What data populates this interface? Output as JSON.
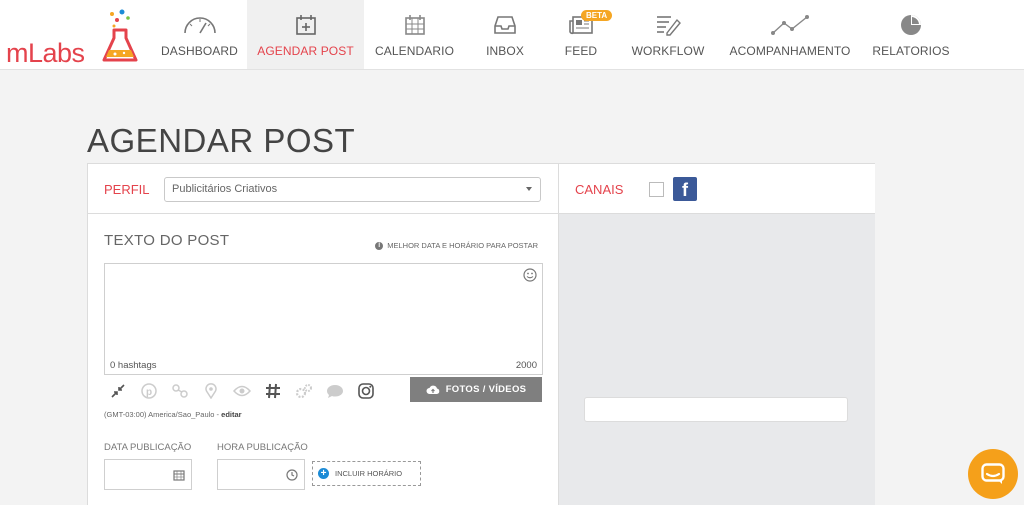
{
  "logo": {
    "text_m": "m",
    "text_labs": "Labs"
  },
  "nav": {
    "items": [
      {
        "label": "DASHBOARD",
        "icon": "gauge-icon"
      },
      {
        "label": "AGENDAR POST",
        "icon": "calendar-plus-icon",
        "active": true
      },
      {
        "label": "CALENDARIO",
        "icon": "calendar-icon"
      },
      {
        "label": "INBOX",
        "icon": "inbox-icon"
      },
      {
        "label": "FEED",
        "icon": "newspaper-icon",
        "badge": "BETA"
      },
      {
        "label": "WORKFLOW",
        "icon": "workflow-icon"
      },
      {
        "label": "ACOMPANHAMENTO",
        "icon": "line-chart-icon"
      },
      {
        "label": "RELATORIOS",
        "icon": "pie-chart-icon"
      }
    ]
  },
  "page": {
    "title": "AGENDAR POST"
  },
  "perfil": {
    "label": "PERFIL",
    "selected": "Publicitários Criativos"
  },
  "canais": {
    "label": "CANAIS",
    "facebook_glyph": "f"
  },
  "post": {
    "label": "TEXTO DO POST",
    "best_time": "MELHOR DATA E HORÁRIO PARA POSTAR",
    "hashtags": "0 hashtags",
    "counter": "2000",
    "fotos_label": "FOTOS / VÍDEOS",
    "timezone": "(GMT-03:00) America/Sao_Paulo -",
    "edit_link": "editar"
  },
  "schedule": {
    "data_label": "DATA PUBLICAÇÃO",
    "hora_label": "HORA PUBLICAÇÃO",
    "incluir_label": "INCLUIR HORÁRIO"
  },
  "colors": {
    "accent": "#e4434c",
    "facebook": "#3b5998",
    "chat": "#f5a01a"
  }
}
